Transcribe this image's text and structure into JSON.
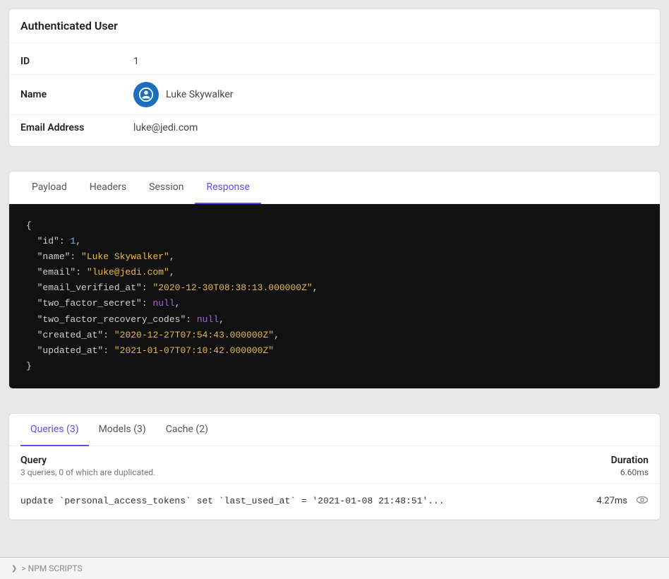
{
  "authenticated_user": {
    "title": "Authenticated User",
    "fields": [
      {
        "label": "ID",
        "value": "1",
        "type": "text"
      },
      {
        "label": "Name",
        "value": "Luke Skywalker",
        "type": "avatar"
      },
      {
        "label": "Email Address",
        "value": "luke@jedi.com",
        "type": "text"
      }
    ]
  },
  "response_tabs": {
    "tabs": [
      "Payload",
      "Headers",
      "Session",
      "Response"
    ],
    "active": "Response",
    "code": {
      "lines": [
        {
          "key": "\"id\"",
          "colon": ": ",
          "value": "1",
          "type": "number",
          "comma": ","
        },
        {
          "key": "\"name\"",
          "colon": ": ",
          "value": "\"Luke Skywalker\"",
          "type": "string",
          "comma": ","
        },
        {
          "key": "\"email\"",
          "colon": ": ",
          "value": "\"luke@jedi.com\"",
          "type": "string",
          "comma": ","
        },
        {
          "key": "\"email_verified_at\"",
          "colon": ": ",
          "value": "\"2020-12-30T08:38:13.000000Z\"",
          "type": "string",
          "comma": ","
        },
        {
          "key": "\"two_factor_secret\"",
          "colon": ": ",
          "value": "null",
          "type": "null",
          "comma": ","
        },
        {
          "key": "\"two_factor_recovery_codes\"",
          "colon": ": ",
          "value": "null",
          "type": "null",
          "comma": ","
        },
        {
          "key": "\"created_at\"",
          "colon": ": ",
          "value": "\"2020-12-27T07:54:43.000000Z\"",
          "type": "string",
          "comma": ","
        },
        {
          "key": "\"updated_at\"",
          "colon": ": ",
          "value": "\"2021-01-07T07:10:42.000000Z\"",
          "type": "string",
          "comma": ""
        }
      ]
    }
  },
  "queries_section": {
    "tabs": [
      "Queries (3)",
      "Models (3)",
      "Cache (2)"
    ],
    "active": "Queries (3)",
    "summary": {
      "query_label": "Query",
      "query_sub": "3 queries, 0 of which are duplicated.",
      "duration_label": "Duration",
      "duration_value": "6.60ms"
    },
    "rows": [
      {
        "text": "update `personal_access_tokens` set `last_used_at` = '2021-01-08 21:48:51'...",
        "duration": "4.27ms"
      }
    ]
  },
  "bottom_bar": {
    "label": "> NPM SCRIPTS"
  }
}
